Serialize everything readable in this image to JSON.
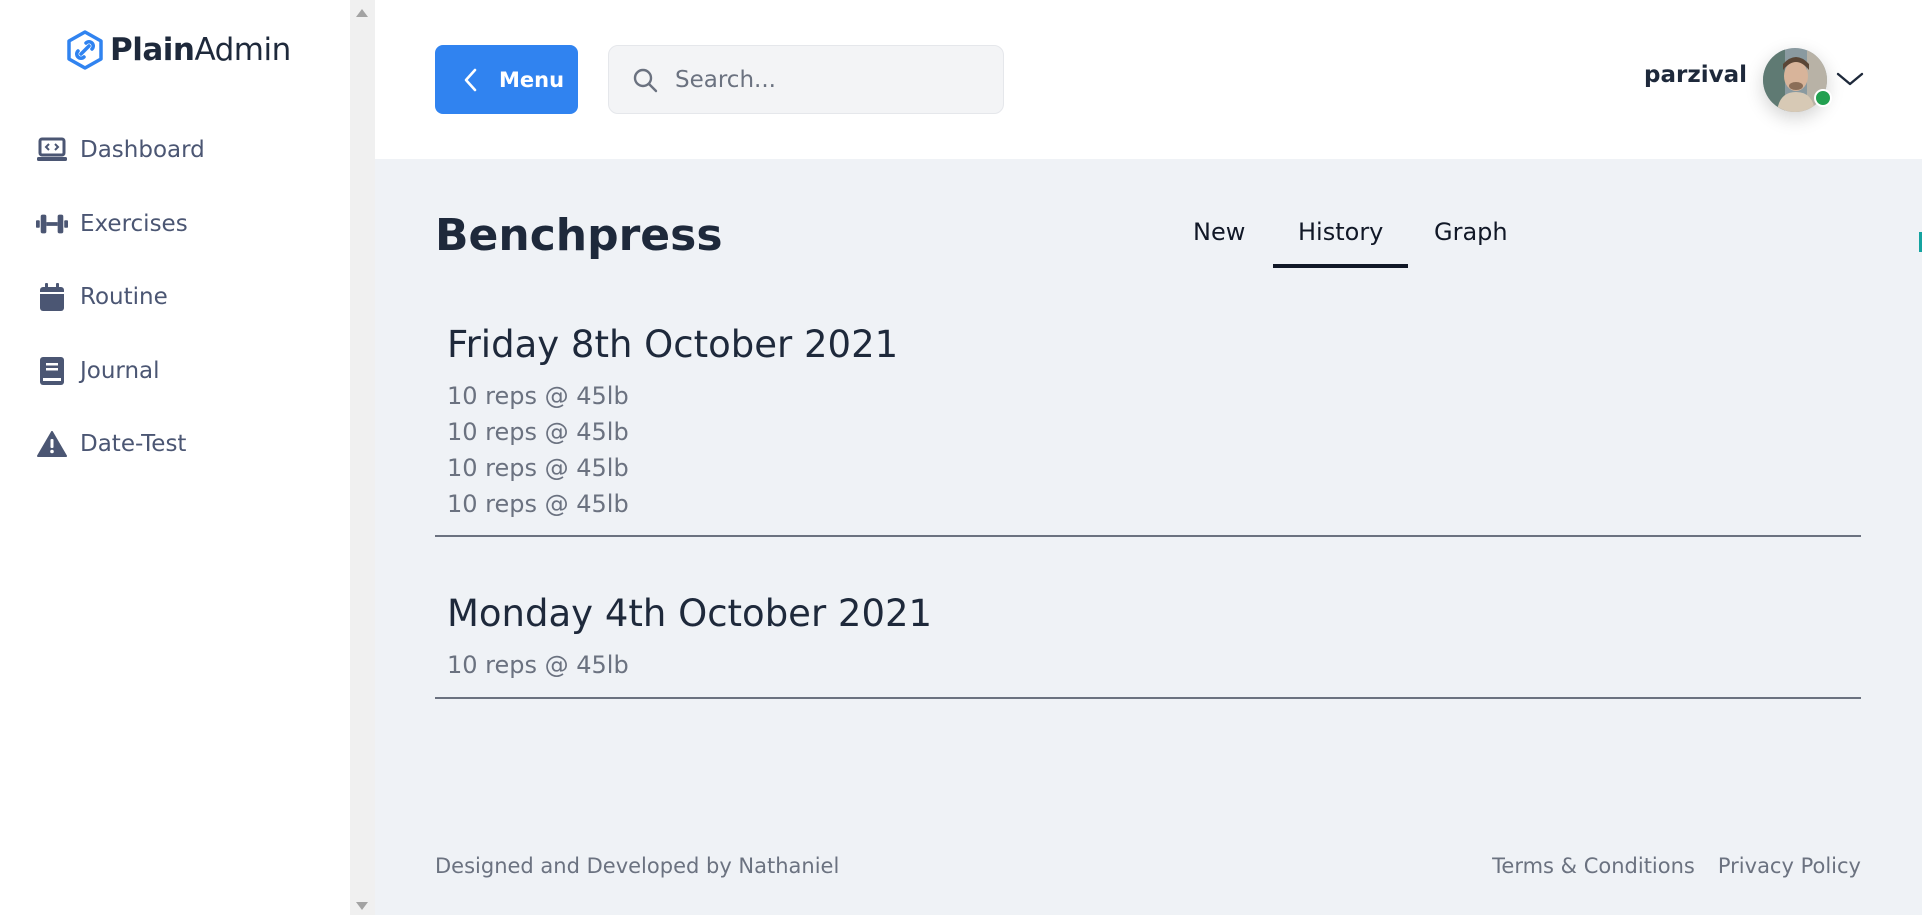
{
  "brand": {
    "bold": "Plain",
    "light": "Admin",
    "color": "#3083f0"
  },
  "sidebar": {
    "items": [
      {
        "label": "Dashboard",
        "icon": "laptop-code-icon"
      },
      {
        "label": "Exercises",
        "icon": "dumbbell-icon"
      },
      {
        "label": "Routine",
        "icon": "calendar-icon"
      },
      {
        "label": "Journal",
        "icon": "book-icon"
      },
      {
        "label": "Date-Test",
        "icon": "warning-icon"
      }
    ]
  },
  "header": {
    "menu_label": "Menu",
    "search_placeholder": "Search...",
    "username": "parzival",
    "status_color": "#22a050"
  },
  "page": {
    "title": "Benchpress",
    "tabs": [
      {
        "label": "New",
        "active": false
      },
      {
        "label": "History",
        "active": true
      },
      {
        "label": "Graph",
        "active": false
      }
    ],
    "entries": [
      {
        "date": "Friday 8th October 2021",
        "sets": [
          "10 reps @ 45lb",
          "10 reps @ 45lb",
          "10 reps @ 45lb",
          "10 reps @ 45lb"
        ]
      },
      {
        "date": "Monday 4th October 2021",
        "sets": [
          "10 reps @ 45lb"
        ]
      }
    ]
  },
  "footer": {
    "credit": "Designed and Developed by Nathaniel",
    "terms": "Terms & Conditions",
    "privacy": "Privacy Policy"
  }
}
